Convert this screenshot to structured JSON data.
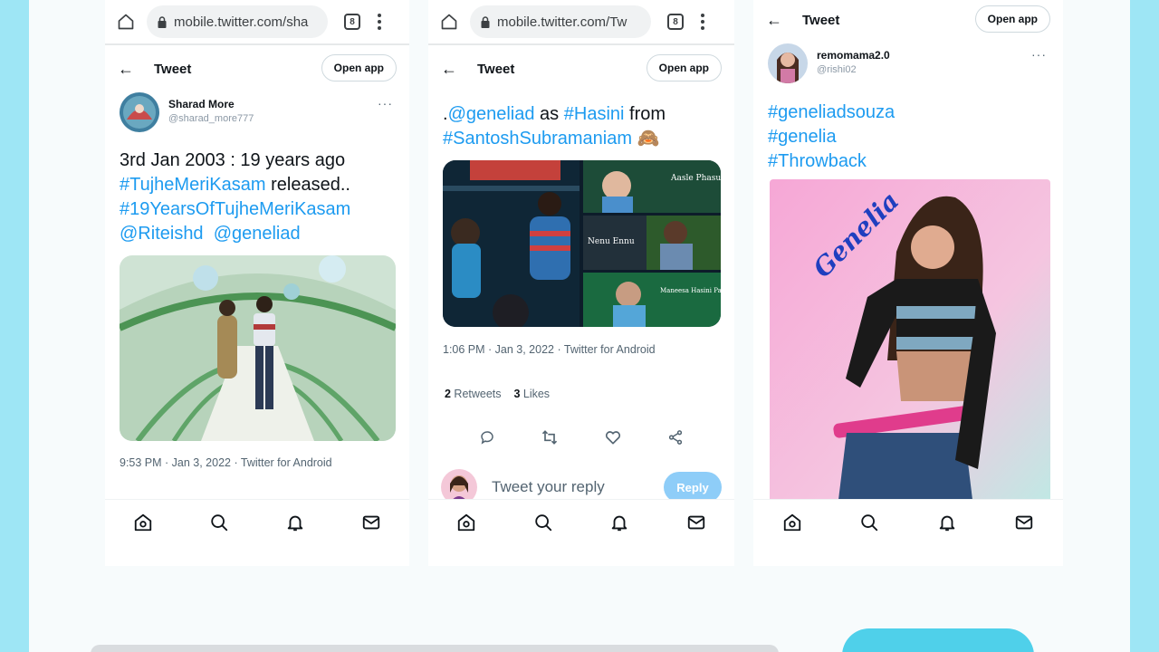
{
  "browser": {
    "url_left": "mobile.twitter.com/sha",
    "url_middle": "mobile.twitter.com/Tw",
    "tab_count": "8"
  },
  "header": {
    "title": "Tweet",
    "open_app": "Open app"
  },
  "tweet1": {
    "name": "Sharad More",
    "handle": "@sharad_more777",
    "more": "···",
    "text_line1": "3rd Jan 2003 : 19 years ago",
    "tag1": "#TujheMeriKasam",
    "after_tag1": " released..",
    "tag2": "#19YearsOfTujheMeriKasam",
    "mention1": "@Riteishd",
    "mention2": "@geneliad",
    "timestamp": "9:53 PM · Jan 3, 2022 · Twitter for Android"
  },
  "tweet2": {
    "prefix": ".",
    "mention": "@geneliad",
    "as": " as ",
    "tag1": "#Hasini",
    "from": " from",
    "tag2": "#SantoshSubramaniam",
    "emoji": "🙈",
    "timestamp": "1:06 PM · Jan 3, 2022 · Twitter for Android",
    "retweets_count": "2",
    "retweets_label": " Retweets",
    "likes_count": "3",
    "likes_label": " Likes",
    "reply_placeholder": "Tweet your reply",
    "reply_button": "Reply",
    "collage_text1": "Aasle Phasuleda",
    "collage_text2": "Nenu Ennu",
    "collage_text3": "Maneesa Hasini Panthi Ilaata Kay tay rasan"
  },
  "tweet3": {
    "name": "remomama2.0",
    "handle": "@rishi02",
    "more": "···",
    "tag1": "#geneliadsouza",
    "tag2": "#genelia",
    "tag3": "#Throwback",
    "poster_text": "Genelia"
  },
  "icons": {
    "home": "home-icon",
    "search": "search-icon",
    "notifications": "bell-icon",
    "messages": "mail-icon"
  },
  "colors": {
    "link": "#1d9bf0",
    "background": "#9ee6f5",
    "reply_button": "#8ecdf8"
  }
}
